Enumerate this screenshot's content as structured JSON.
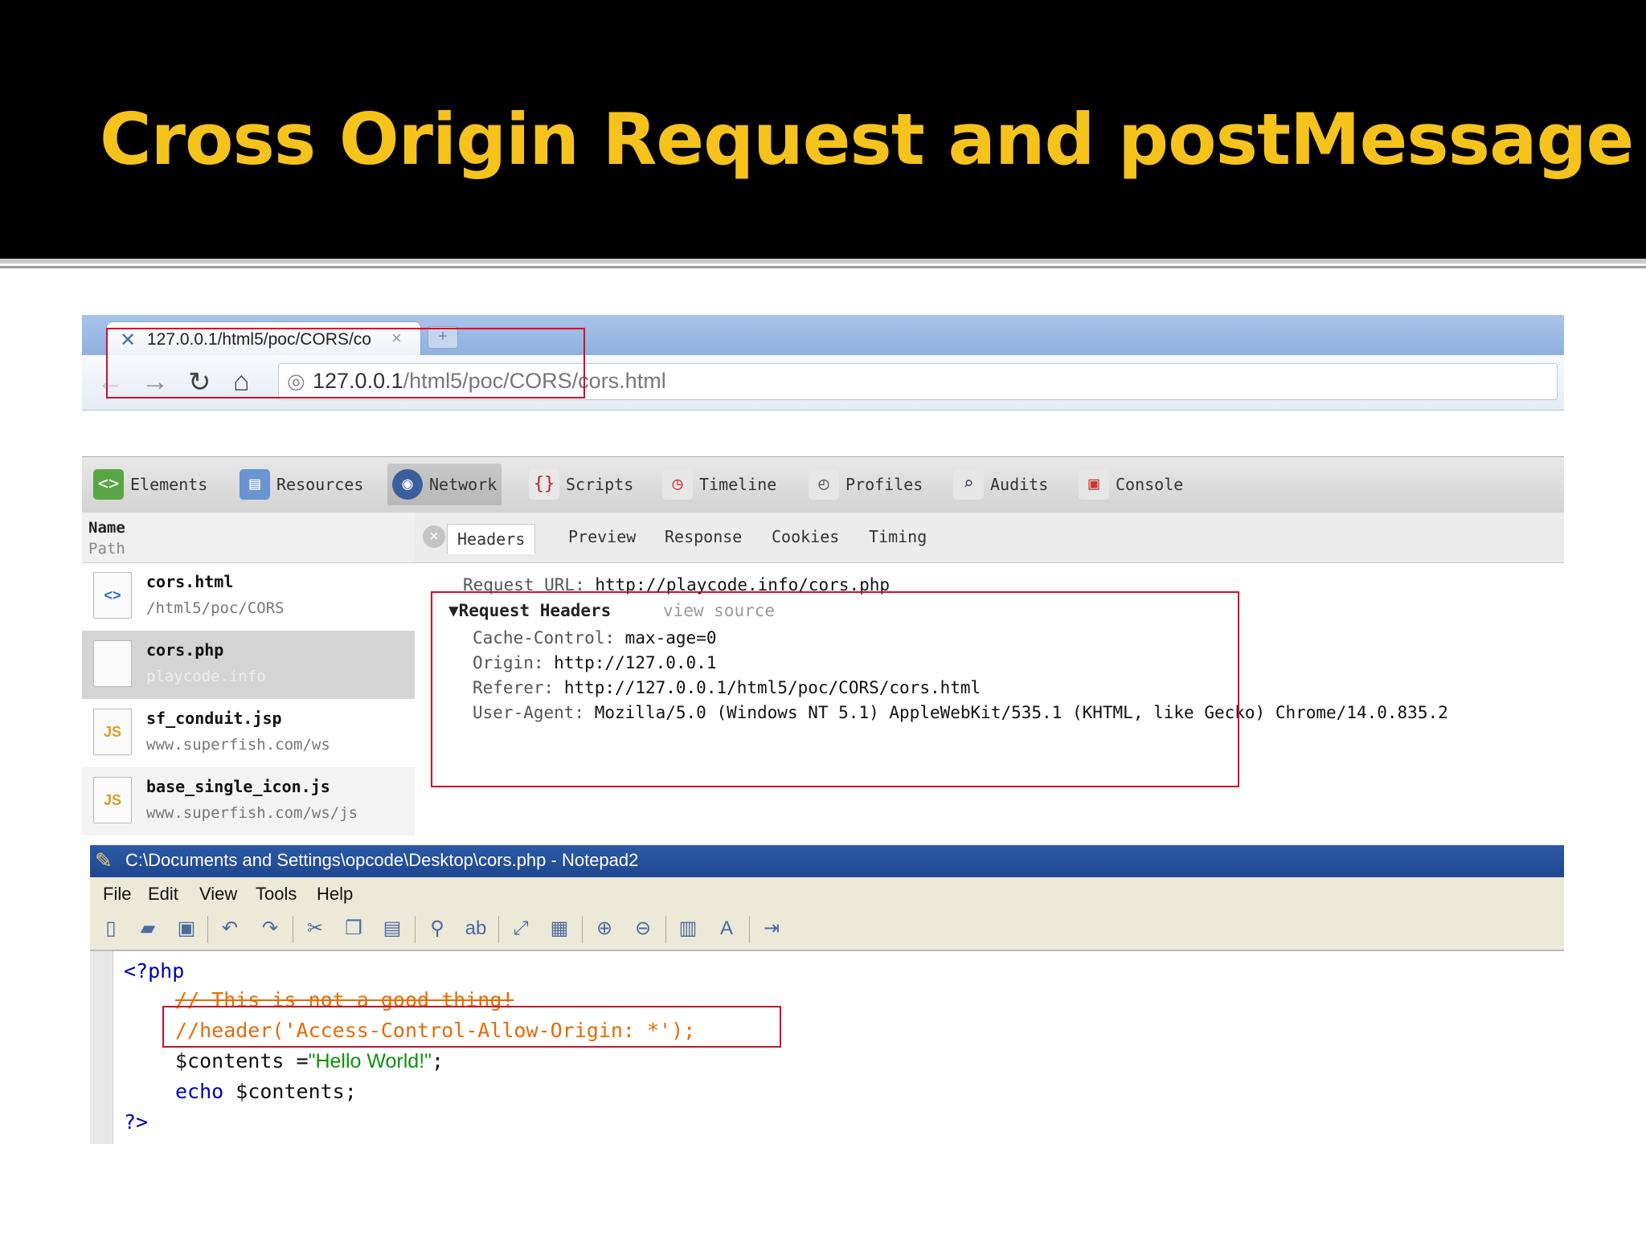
{
  "slide": {
    "title": "Cross Origin Request and postMessage"
  },
  "browser": {
    "tab_title": "127.0.0.1/html5/poc/CORS/co",
    "tab_close": "×",
    "new_tab": "+",
    "url_host": "127.0.0.1",
    "url_path": "/html5/poc/CORS/cors.html"
  },
  "devtools": {
    "tools": [
      {
        "label": "Elements",
        "icon": "elements-icon"
      },
      {
        "label": "Resources",
        "icon": "resources-icon"
      },
      {
        "label": "Network",
        "icon": "network-icon",
        "active": true
      },
      {
        "label": "Scripts",
        "icon": "scripts-icon"
      },
      {
        "label": "Timeline",
        "icon": "timeline-icon"
      },
      {
        "label": "Profiles",
        "icon": "profiles-icon"
      },
      {
        "label": "Audits",
        "icon": "audits-icon"
      },
      {
        "label": "Console",
        "icon": "console-icon"
      }
    ],
    "sidebar_header": {
      "name": "Name",
      "path": "Path"
    },
    "resources": [
      {
        "name": "cors.html",
        "path": "/html5/poc/CORS",
        "icon": "html-file-icon",
        "glyph": "<>"
      },
      {
        "name": "cors.php",
        "path": "playcode.info",
        "icon": "blank-file-icon",
        "glyph": "",
        "selected": true
      },
      {
        "name": "sf_conduit.jsp",
        "path": "www.superfish.com/ws",
        "icon": "js-file-icon",
        "glyph": "JS"
      },
      {
        "name": "base_single_icon.js",
        "path": "www.superfish.com/ws/js",
        "icon": "js-file-icon",
        "glyph": "JS"
      }
    ],
    "detail_tabs": [
      "Headers",
      "Preview",
      "Response",
      "Cookies",
      "Timing"
    ],
    "active_detail_tab": "Headers",
    "request_url_label": "Request URL:",
    "request_url": "http://playcode.info/cors.php",
    "request_headers_label": "▼Request Headers",
    "view_source": "view source",
    "headers": [
      {
        "key": "Cache-Control:",
        "value": "max-age=0"
      },
      {
        "key": "Origin:",
        "value": "http://127.0.0.1"
      },
      {
        "key": "Referer:",
        "value": "http://127.0.0.1/html5/poc/CORS/cors.html"
      },
      {
        "key": "User-Agent:",
        "value": "Mozilla/5.0 (Windows NT 5.1) AppleWebKit/535.1 (KHTML, like Gecko) Chrome/14.0.835.2"
      }
    ]
  },
  "notepad": {
    "title": "C:\\Documents and Settings\\opcode\\Desktop\\cors.php - Notepad2",
    "menu": [
      "File",
      "Edit",
      "View",
      "Tools",
      "Help"
    ],
    "code": {
      "open": "<?php",
      "comment1": "// This is not a good thing!",
      "comment2": "//header('Access-Control-Allow-Origin: *');",
      "assign_var": "$contents =",
      "assign_str": "\"Hello World!\"",
      "assign_end": ";",
      "echo_kw": "echo",
      "echo_var": " $contents;",
      "close": "?>"
    }
  },
  "colors": {
    "title_text": "#f6c21c",
    "highlight_box": "#d0102a",
    "comment": "#e36c09",
    "string": "#109010"
  }
}
